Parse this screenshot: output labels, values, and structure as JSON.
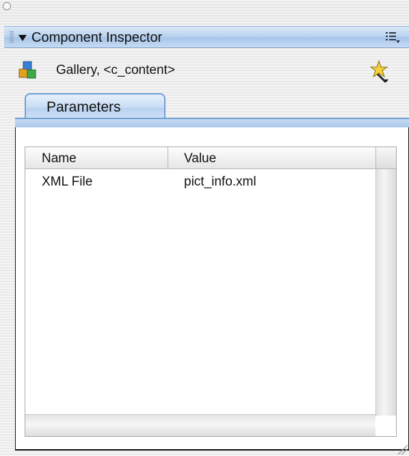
{
  "panel": {
    "title": "Component Inspector",
    "component_label": "Gallery, <c_content>"
  },
  "tabs": [
    {
      "label": "Parameters",
      "active": true
    }
  ],
  "grid": {
    "columns": [
      "Name",
      "Value"
    ],
    "rows": [
      {
        "name": "XML File",
        "value": "pict_info.xml"
      }
    ]
  },
  "icons": {
    "panel_options": "panel-options-icon",
    "component": "component-icon",
    "wizard": "behaviors-wizard-icon"
  },
  "colors": {
    "header_blue": "#bcd4ef",
    "tab_border": "#6f9fd8"
  }
}
